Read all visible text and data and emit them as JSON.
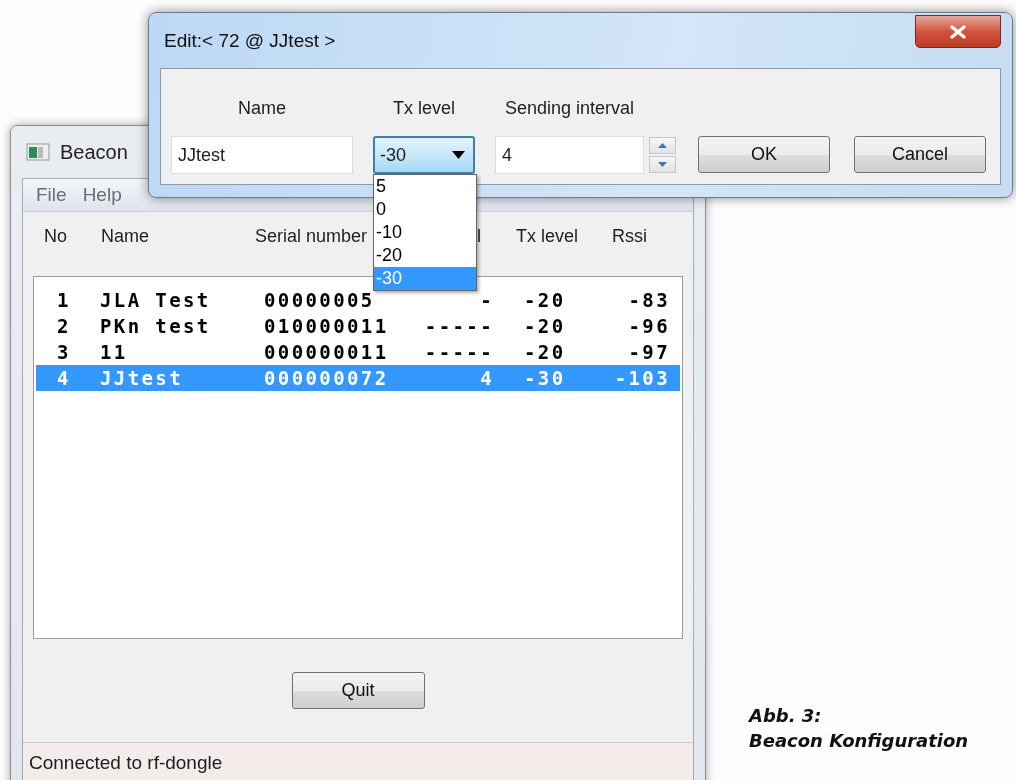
{
  "main_window": {
    "title": "Beacon",
    "menu": [
      {
        "label": "File"
      },
      {
        "label": "Help"
      }
    ],
    "columns": [
      "No",
      "Name",
      "Serial number",
      "l",
      "Tx level",
      "Rssi"
    ],
    "rows": [
      {
        "no": "1",
        "name": "JLA Test",
        "serial": "00000005",
        "interval": "-",
        "tx_level": "-20",
        "rssi": "-83",
        "selected": false
      },
      {
        "no": "2",
        "name": "PKn test",
        "serial": "010000011",
        "interval": "-----",
        "tx_level": "-20",
        "rssi": "-96",
        "selected": false
      },
      {
        "no": "3",
        "name": "11",
        "serial": "000000011",
        "interval": "-----",
        "tx_level": "-20",
        "rssi": "-97",
        "selected": false
      },
      {
        "no": "4",
        "name": "JJtest",
        "serial": "000000072",
        "interval": "4",
        "tx_level": "-30",
        "rssi": "-103",
        "selected": true
      }
    ],
    "buttons": [
      "Quit"
    ],
    "status_bar": "Connected to rf-dongle"
  },
  "dialog": {
    "title": "Edit:< 72 @ JJtest >",
    "labels": [
      "Name",
      "Tx level",
      "Sending interval"
    ],
    "name_value": "JJtest",
    "tx_level": {
      "value": "-30",
      "expanded": true,
      "options": [
        {
          "label": "5",
          "selected": false
        },
        {
          "label": "0",
          "selected": false
        },
        {
          "label": "-10",
          "selected": false
        },
        {
          "label": "-20",
          "selected": false
        },
        {
          "label": "-30",
          "selected": true
        }
      ]
    },
    "interval_value": "4",
    "buttons": [
      "OK",
      "Cancel"
    ]
  },
  "caption": [
    "Abb. 3:",
    "Beacon Konfiguration"
  ]
}
